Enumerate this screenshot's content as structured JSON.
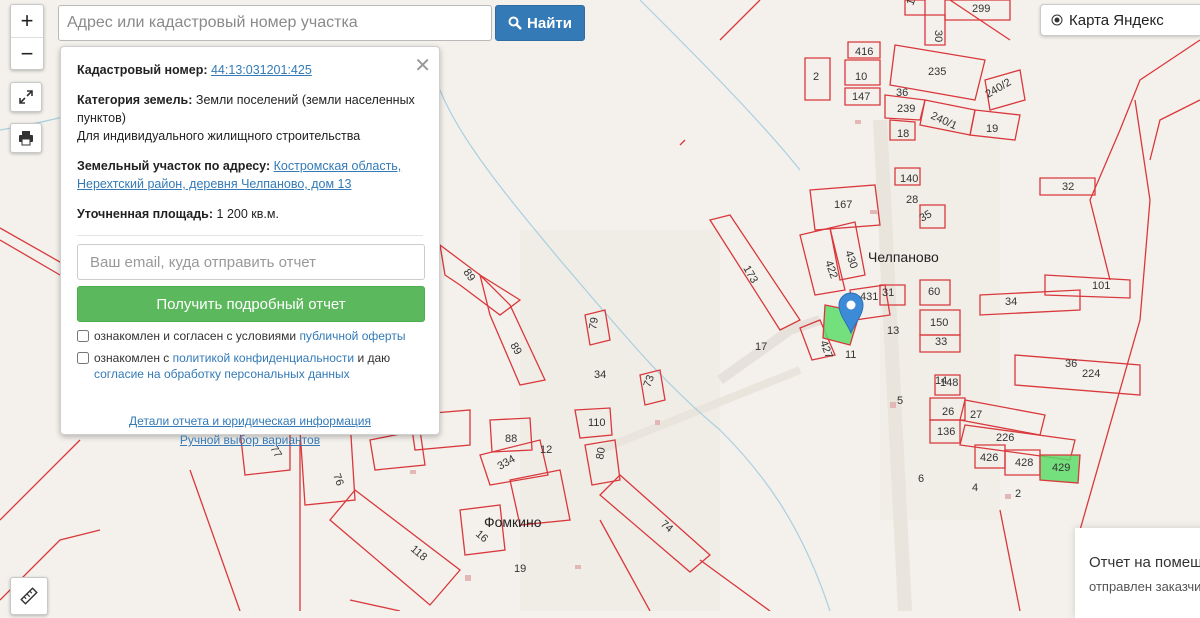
{
  "map": {
    "villages": [
      "Челпаново",
      "Фомкино"
    ],
    "parcels": [
      {
        "label": "299"
      },
      {
        "label": "15"
      },
      {
        "label": "30"
      },
      {
        "label": "416"
      },
      {
        "label": "10"
      },
      {
        "label": "147"
      },
      {
        "label": "2"
      },
      {
        "label": "235"
      },
      {
        "label": "36"
      },
      {
        "label": "239"
      },
      {
        "label": "240/1"
      },
      {
        "label": "240/2"
      },
      {
        "label": "18"
      },
      {
        "label": "19"
      },
      {
        "label": "140"
      },
      {
        "label": "167"
      },
      {
        "label": "28"
      },
      {
        "label": "35"
      },
      {
        "label": "32"
      },
      {
        "label": "173"
      },
      {
        "label": "422"
      },
      {
        "label": "430"
      },
      {
        "label": "431"
      },
      {
        "label": "31"
      },
      {
        "label": "60"
      },
      {
        "label": "34"
      },
      {
        "label": "101"
      },
      {
        "label": "150"
      },
      {
        "label": "33"
      },
      {
        "label": "427"
      },
      {
        "label": "13"
      },
      {
        "label": "11"
      },
      {
        "label": "17"
      },
      {
        "label": "89"
      },
      {
        "label": "89"
      },
      {
        "label": "79"
      },
      {
        "label": "34"
      },
      {
        "label": "73"
      },
      {
        "label": "110"
      },
      {
        "label": "88"
      },
      {
        "label": "12"
      },
      {
        "label": "334"
      },
      {
        "label": "80"
      },
      {
        "label": "74"
      },
      {
        "label": "77"
      },
      {
        "label": "76"
      },
      {
        "label": "118"
      },
      {
        "label": "16"
      },
      {
        "label": "19"
      },
      {
        "label": "36"
      },
      {
        "label": "224"
      },
      {
        "label": "5"
      },
      {
        "label": "148"
      },
      {
        "label": "26"
      },
      {
        "label": "27"
      },
      {
        "label": "136"
      },
      {
        "label": "226"
      },
      {
        "label": "426"
      },
      {
        "label": "428"
      },
      {
        "label": "429"
      },
      {
        "label": "6"
      },
      {
        "label": "4"
      },
      {
        "label": "2"
      },
      {
        "label": "14"
      }
    ],
    "colors": {
      "boundary": "#d9383c",
      "highlight": "#5ddc6a",
      "marker": "#3d8bd6",
      "background": "#f4f1ec"
    }
  },
  "controls": {
    "zoom_in": "+",
    "zoom_out": "−",
    "fullscreen_icon": "expand-icon",
    "print_icon": "printer-icon",
    "ruler_icon": "ruler-icon"
  },
  "search": {
    "placeholder": "Адрес или кадастровый номер участка",
    "button_label": "Найти"
  },
  "layer_switch": {
    "label": "Карта Яндекс"
  },
  "popup": {
    "cadastral_label": "Кадастровый номер:",
    "cadastral_value": "44:13:031201:425",
    "category_label": "Категория земель:",
    "category_value": "Земли поселений (земли населенных пунктов)",
    "usage_value": "Для индивидуального жилищного строительства",
    "address_label": "Земельный участок по адресу:",
    "address_value": "Костромская область, Нерехтский район, деревня Челпаново, дом 13",
    "area_label": "Уточненная площадь:",
    "area_value": "1 200 кв.м.",
    "email_placeholder": "Ваш email, куда отправить отчет",
    "report_button": "Получить подробный отчет",
    "agree1_pre": "ознакомлен и согласен с условиями ",
    "agree1_link": "публичной оферты",
    "agree2_pre": "ознакомлен с ",
    "agree2_link": "политикой конфиденциальности",
    "agree2_mid": " и даю ",
    "agree2_link2": "согласие на обработку персональных данных",
    "link_details": "Детали отчета и юридическая информация",
    "link_manual": "Ручной выбор вариантов"
  },
  "toast": {
    "title": "Отчет на помещ",
    "subtitle": "отправлен заказчи"
  }
}
